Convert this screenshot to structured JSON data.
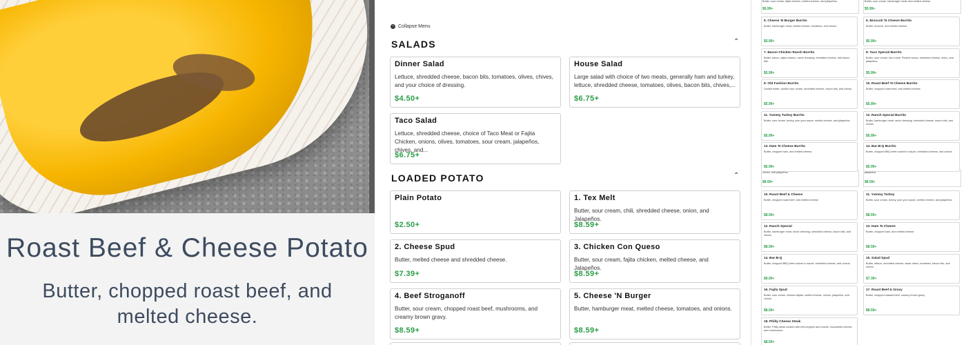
{
  "detail": {
    "title": "Roast Beef & Cheese Potato",
    "description": "Butter, chopped roast beef, and melted cheese."
  },
  "menu": {
    "collapse_label": "Collapse Menu",
    "salads": {
      "title": "SALADS",
      "items": [
        {
          "name": "Dinner Salad",
          "desc": "Lettuce, shredded cheese, bacon bits, tomatoes, olives, chives, and your choice of dressing.",
          "price": "$4.50+"
        },
        {
          "name": "House Salad",
          "desc": "Large salad with choice of two meats, generally ham and turkey, lettuce, shredded cheese, tomatoes, olives, bacon bits, chives,...",
          "price": "$6.75+"
        },
        {
          "name": "Taco Salad",
          "desc": "Lettuce, shredded cheese, choice of Taco Meat or Fajita Chicken, onions, olives, tomatoes, sour cream, jalapeños, chives, and...",
          "price": "$6.75+"
        }
      ]
    },
    "loaded_potato": {
      "title": "LOADED POTATO",
      "items": [
        {
          "name": "Plain Potato",
          "desc": "",
          "price": "$2.50+"
        },
        {
          "name": "1. Tex Melt",
          "desc": "Butter, sour cream, chili, shredded cheese, onion, and Jalapeños.",
          "price": "$8.59+"
        },
        {
          "name": "2. Cheese Spud",
          "desc": "Butter, melted cheese and shredded cheese.",
          "price": "$7.39+"
        },
        {
          "name": "3. Chicken Con Queso",
          "desc": "Butter, sour cream, fajita chicken, melted cheese, and Jalapeños.",
          "price": "$8.59+"
        },
        {
          "name": "4. Beef Stroganoff",
          "desc": "Butter, sour cream, chopped roast beef, mushrooms, and creamy brown gravy.",
          "price": "$8.59+"
        },
        {
          "name": "5. Cheese 'N Burger",
          "desc": "Butter, hamburger meat, melted cheese, tomatoes, and onions.",
          "price": "$8.59+"
        }
      ]
    }
  },
  "right_panel": {
    "top_fragments": {
      "left_desc": "Butter, sour cream, fajita chicken, melted cheese, and jalapeños.",
      "right_desc": "Butter, sour cream, hamburger meat, and melted cheese."
    },
    "top_prices": [
      "$5.99+",
      "$5.99+"
    ],
    "burritos": [
      {
        "name": "5. Cheese 'N Burger Burrito",
        "desc": "Butter, hamburger meat, melted cheese, tomatoes, and onions.",
        "price": "$5.99+"
      },
      {
        "name": "6. Broccoli 'N Cheese Burrito",
        "desc": "Butter, broccoli, and melted cheese.",
        "price": "$5.99+"
      },
      {
        "name": "7. Bacon Chicken Ranch Burrito",
        "desc": "Butter, bacon, fajita chicken, ranch dressing, shredded cheese, and bacon bits.",
        "price": "$5.99+"
      },
      {
        "name": "8. Taco Special Burrito",
        "desc": "Butter, sour cream, taco meat, Picante sauce, shredded cheese, onion, and jalapeños.",
        "price": "$5.99+"
      },
      {
        "name": "9. Old Fashion Burrito",
        "desc": "Double butter, double sour cream, shredded cheese, bacon bits, and chives.",
        "price": "$5.99+"
      },
      {
        "name": "10. Roast Beef 'N Cheese Burrito",
        "desc": "Butter, chopped roast beef, and melted cheese.",
        "price": "$5.99+"
      },
      {
        "name": "11. Yummy Turkey Burrito",
        "desc": "Butter, sour cream, turkey, yum yum sauce, melted cheese, and jalapeños.",
        "price": "$5.99+"
      },
      {
        "name": "12. Ranch Special Burrito",
        "desc": "Butter, hamburger meat, ranch dressing, shredded cheese, bacon bits, and chives.",
        "price": "$5.99+"
      },
      {
        "name": "13. Ham 'N Cheese Burrito",
        "desc": "Butter, chopped ham, and melted cheese.",
        "price": "$5.99+"
      },
      {
        "name": "14. Bar-B-Q Burrito",
        "desc": "Butter, chopped BBQ beef cooked in sauce, shredded cheese, and onions.",
        "price": "$5.99+"
      }
    ],
    "mid_fragments": {
      "left": "chives, and jalapeños.",
      "right": "jalapeños."
    },
    "mid_prices": [
      "$8.59+",
      "$8.59+"
    ],
    "potatoes": [
      {
        "name": "10. Roast Beef & Cheese",
        "desc": "Butter, chopped roast beef, and melted cheese.",
        "price": "$8.59+"
      },
      {
        "name": "11. Yummy Turkey",
        "desc": "Butter, sour cream, turkey, yum yum sauce, melted cheese, and jalapeños.",
        "price": "$8.59+"
      },
      {
        "name": "12. Ranch Special",
        "desc": "Butter, hamburger meat, ranch dressing, shredded cheese, bacon bits, and chives.",
        "price": "$8.59+"
      },
      {
        "name": "13. Ham 'N Cheese",
        "desc": "Butter, chopped ham, and melted cheese.",
        "price": "$8.59+"
      },
      {
        "name": "14. Bar-B-Q",
        "desc": "Butter, chopped BBQ beef cooked in sauce, shredded cheese, and onions.",
        "price": "$9.00+"
      },
      {
        "name": "15. Salad Spud",
        "desc": "Butter, lettuce, shredded cheese, black olives, tomatoes, bacon bits, and chives.",
        "price": "$7.39+"
      },
      {
        "name": "16. Fajita Spud",
        "desc": "Butter, sour cream, chicken fajitas, melted cheese, onions, jalapeños, and chives.",
        "price": "$8.59+"
      },
      {
        "name": "17. Roast Beef & Gravy",
        "desc": "Butter, chopped roasted beef, creamy brown gravy.",
        "price": "$8.59+"
      },
      {
        "name": "18. Philly Cheese Steak",
        "desc": "Butter, Philly steak cooked with bell peppers and onions, mozzarella cheese, and mushrooms.",
        "price": "$8.59+"
      }
    ]
  },
  "colors": {
    "price": "#2a9d46",
    "title_text": "#3d4b5f"
  },
  "icons": {
    "collapse": "collapse-icon",
    "section_toggle": "chevron-up-icon"
  }
}
